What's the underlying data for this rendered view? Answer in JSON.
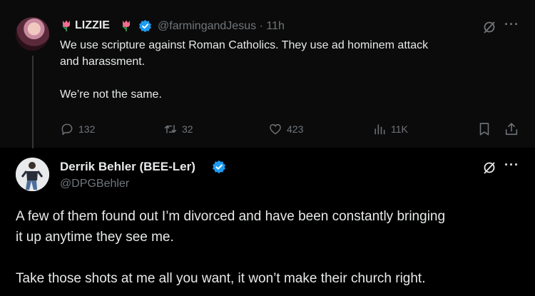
{
  "parent_tweet": {
    "display_name": "LIZZIE",
    "handle": "@farmingandJesus",
    "separator": "·",
    "time": "11h",
    "text": "We use scripture against Roman Catholics. They use ad hominem attack\nand harassment.\n\nWe’re not the same.",
    "actions": {
      "replies": "132",
      "reposts": "32",
      "likes": "423",
      "views": "11K"
    },
    "icons": [
      "tulip-icon",
      "verified-badge-icon",
      "grok-icon",
      "more-icon",
      "reply-icon",
      "repost-icon",
      "like-icon",
      "views-icon",
      "bookmark-icon",
      "share-icon"
    ]
  },
  "main_tweet": {
    "display_name": "Derrik Behler (BEE-Ler)",
    "handle": "@DPGBehler",
    "text": "A few of them found out I’m divorced and have been constantly bringing\nit up anytime they see me.\n\nTake those shots at me all you want, it won’t make their church right."
  },
  "colors": {
    "background": "#000000",
    "parent_background": "#0b0b0b",
    "text": "#e7e9ea",
    "muted": "#71767b",
    "verified_blue": "#1d9bf0",
    "tulip_pink": "#f26d8f"
  }
}
